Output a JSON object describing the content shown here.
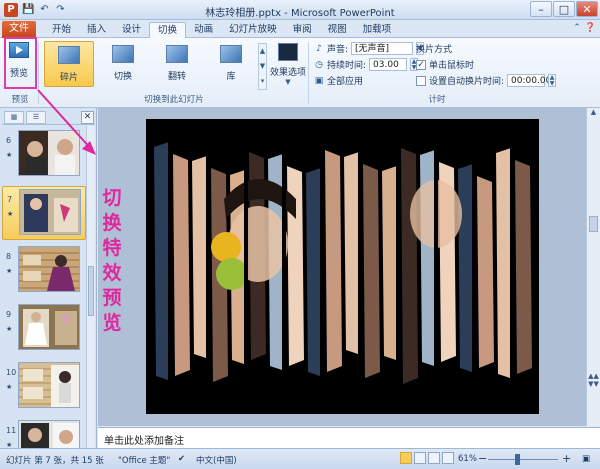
{
  "window": {
    "title": "林志玲相册.pptx - Microsoft PowerPoint",
    "app_icon": "P",
    "quick_access": [
      "save-icon",
      "undo-icon",
      "redo-icon"
    ]
  },
  "tabs": {
    "file": "文件",
    "items": [
      "开始",
      "插入",
      "设计",
      "切换",
      "动画",
      "幻灯片放映",
      "审阅",
      "视图",
      "加载项"
    ],
    "active": "切换"
  },
  "ribbon": {
    "preview": {
      "label": "预览",
      "group": "预览"
    },
    "transitions": {
      "items": [
        "碎片",
        "切换",
        "翻转",
        "库"
      ],
      "selected": "碎片",
      "group": "切换到此幻灯片",
      "effect_options": "效果选项"
    },
    "timing": {
      "group": "计时",
      "sound_label": "声音:",
      "sound_value": "[无声音]",
      "duration_label": "持续时间:",
      "duration_value": "03.00",
      "apply_all": "全部应用",
      "advance_title": "换片方式",
      "on_click": "单击鼠标时",
      "on_click_checked": true,
      "after_label": "设置自动换片时间:",
      "after_checked": false,
      "after_value": "00:00.00"
    }
  },
  "annotation": {
    "text": [
      "切",
      "换",
      "特",
      "效",
      "预",
      "览"
    ],
    "color": "#e0289e"
  },
  "slides_panel": {
    "slides": [
      {
        "num": "6"
      },
      {
        "num": "7"
      },
      {
        "num": "8"
      },
      {
        "num": "9"
      },
      {
        "num": "10"
      },
      {
        "num": "11"
      }
    ],
    "selected": "7"
  },
  "notes": {
    "placeholder": "单击此处添加备注"
  },
  "status": {
    "slide_info": "幻灯片 第 7 张，共 15 张",
    "theme": "\"Office 主题\"",
    "language": "中文(中国)",
    "zoom": "61%"
  }
}
